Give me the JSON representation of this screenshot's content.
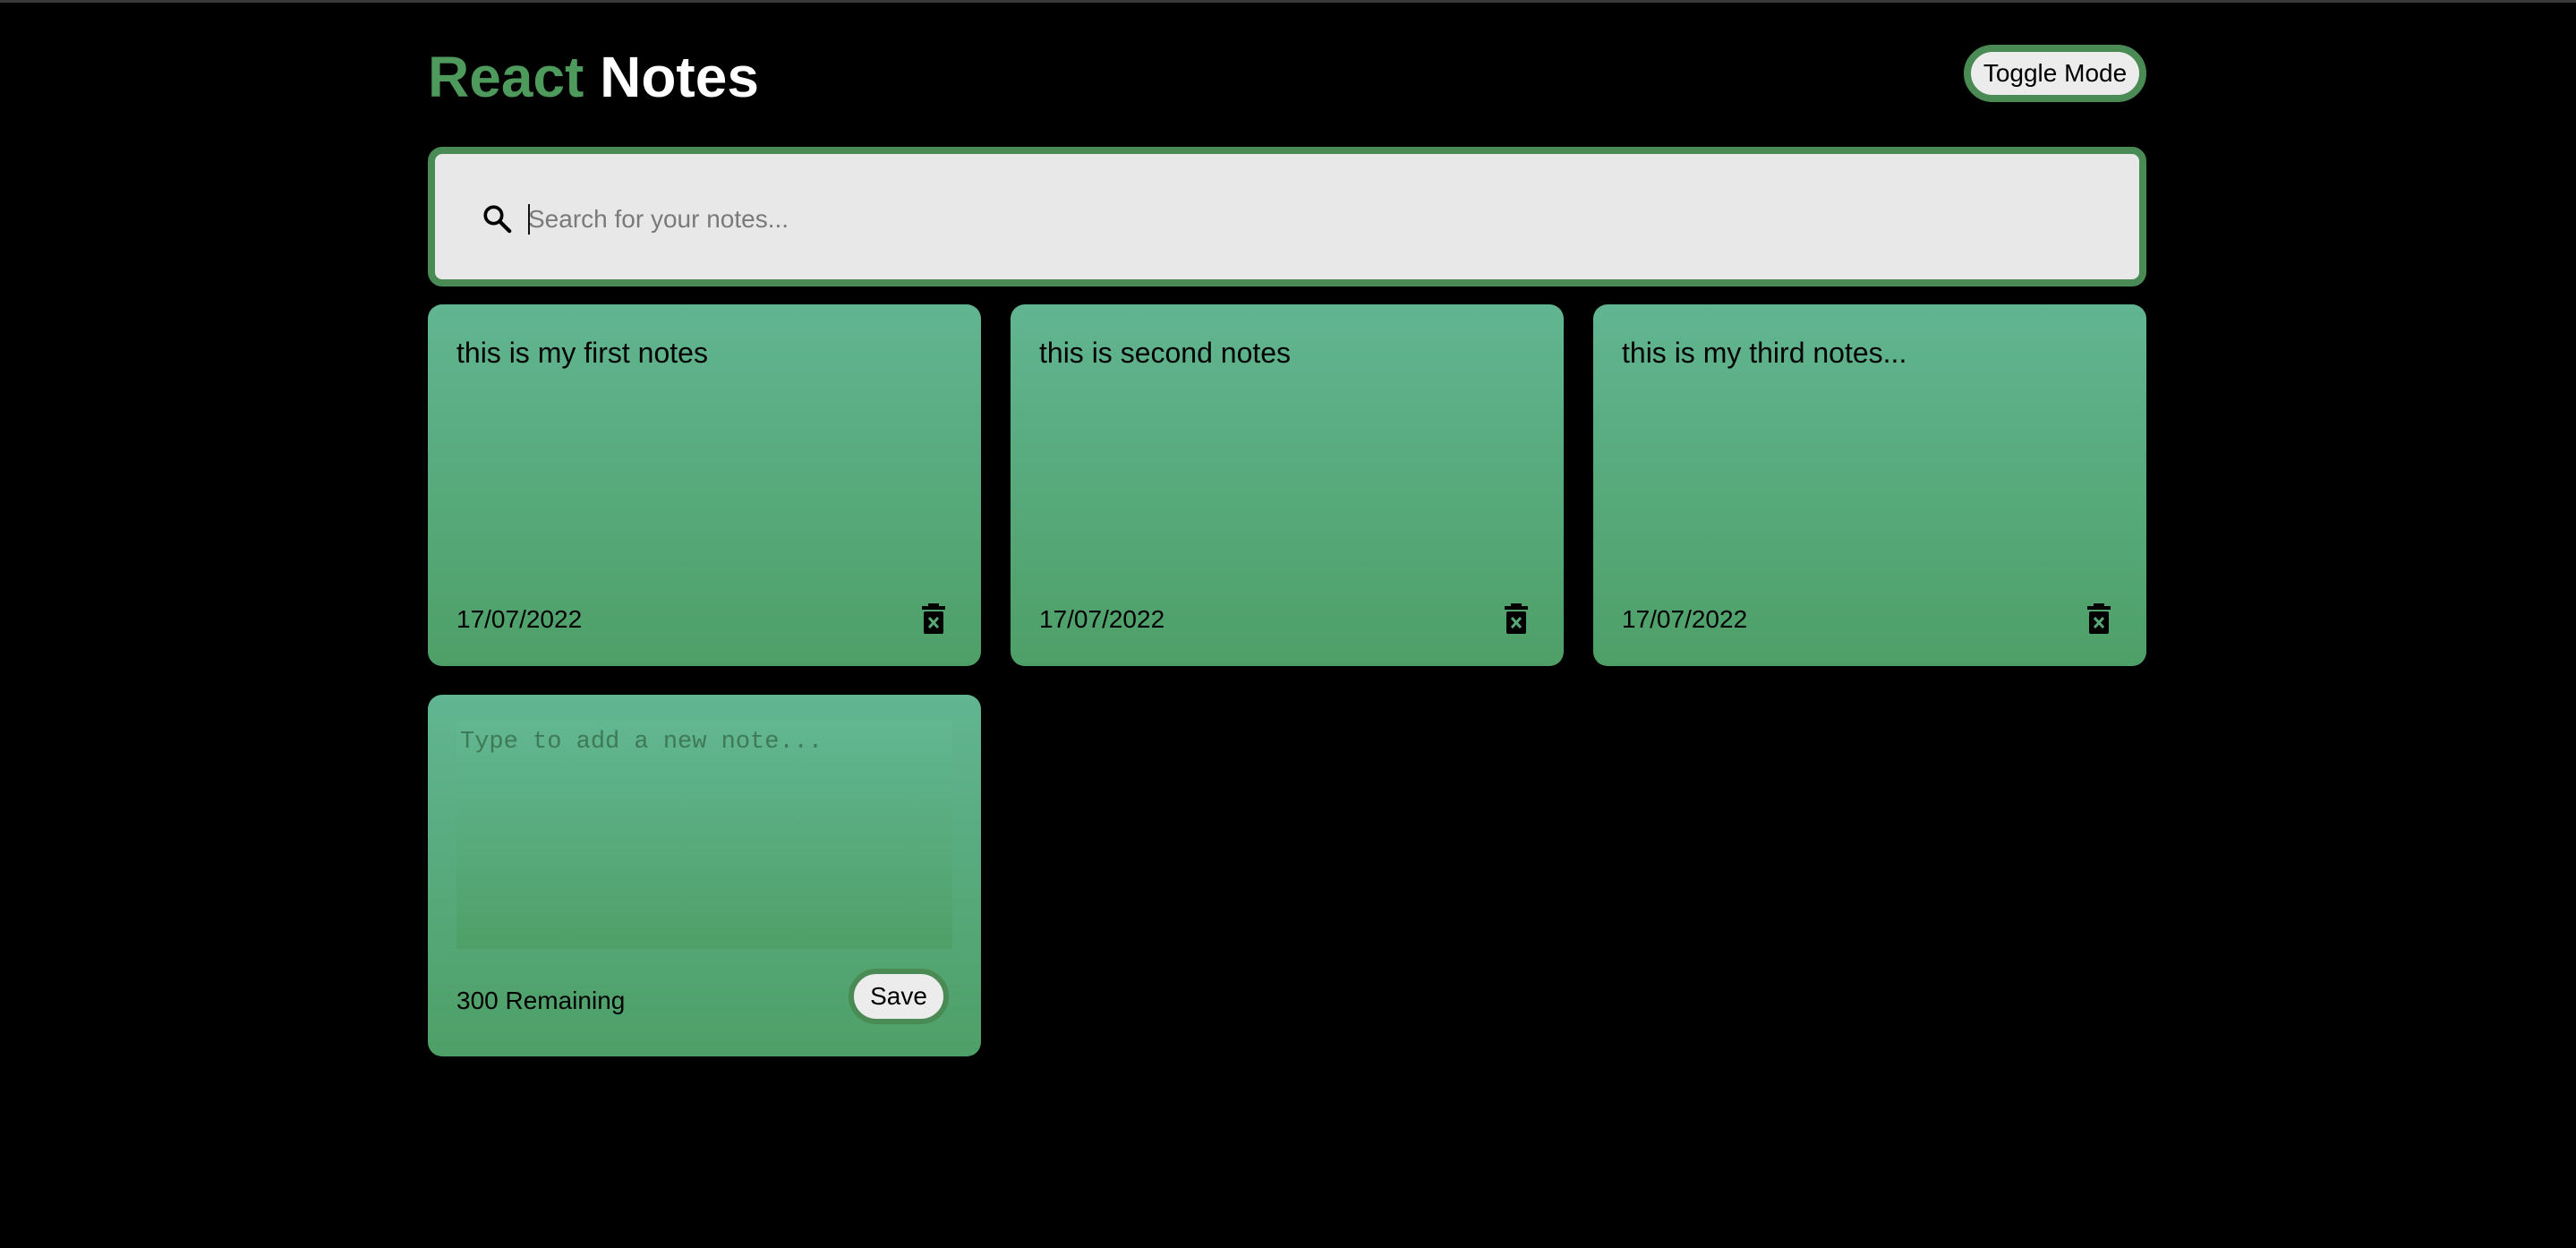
{
  "header": {
    "title_accent": "React",
    "title_main": "Notes",
    "toggle_label": "Toggle Mode"
  },
  "search": {
    "icon": "search-icon",
    "placeholder": "Search for your notes...",
    "value": ""
  },
  "notes": [
    {
      "text": "this is my first notes",
      "date": "17/07/2022",
      "delete_icon": "trash-icon"
    },
    {
      "text": "this is second notes",
      "date": "17/07/2022",
      "delete_icon": "trash-icon"
    },
    {
      "text": "this is my third notes...",
      "date": "17/07/2022",
      "delete_icon": "trash-icon"
    }
  ],
  "new_note": {
    "placeholder": "Type to add a new note...",
    "value": "",
    "remaining": "300 Remaining",
    "save_label": "Save"
  },
  "colors": {
    "background": "#000000",
    "accent": "#4e9a5d",
    "note_top": "#61b591",
    "note_bottom": "#4e9f67",
    "button_bg": "#ececec"
  }
}
